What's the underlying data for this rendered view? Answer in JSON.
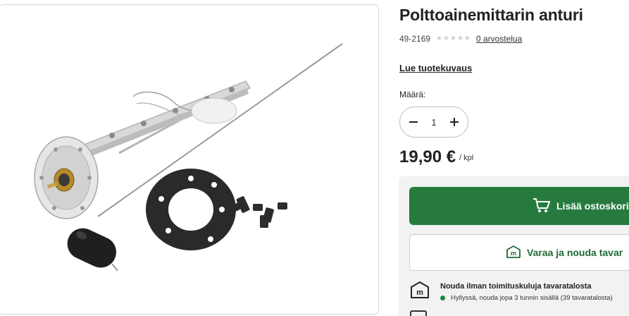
{
  "product": {
    "title": "Polttoainemittarin anturi",
    "sku": "49-2169",
    "rating_stars": 5,
    "reviews_link": "0 arvostelua",
    "read_description_link": "Lue tuotekuvaus",
    "image_icon": "fuel-level-sensor-photo"
  },
  "quantity": {
    "label": "Määrä:",
    "value": "1",
    "decrement_icon": "minus-icon",
    "increment_icon": "plus-icon"
  },
  "price": {
    "amount": "19,90 €",
    "unit": "/ kpl"
  },
  "actions": {
    "add_to_cart_label": "Lisää ostoskori",
    "add_to_cart_icon": "cart-icon",
    "reserve_label": "Varaa ja nouda tavar",
    "reserve_icon": "store-m-icon"
  },
  "pickup": {
    "title": "Nouda ilman toimituskuluja tavaratalosta",
    "status": "Hyllyssä, nouda jopa 3 tunnin sisällä (39 tavaratalosta)",
    "status_color": "#1e8a3c"
  },
  "colors": {
    "primary_green": "#267a3e",
    "text_dark": "#222222",
    "panel_bg": "#f2f2f2"
  }
}
